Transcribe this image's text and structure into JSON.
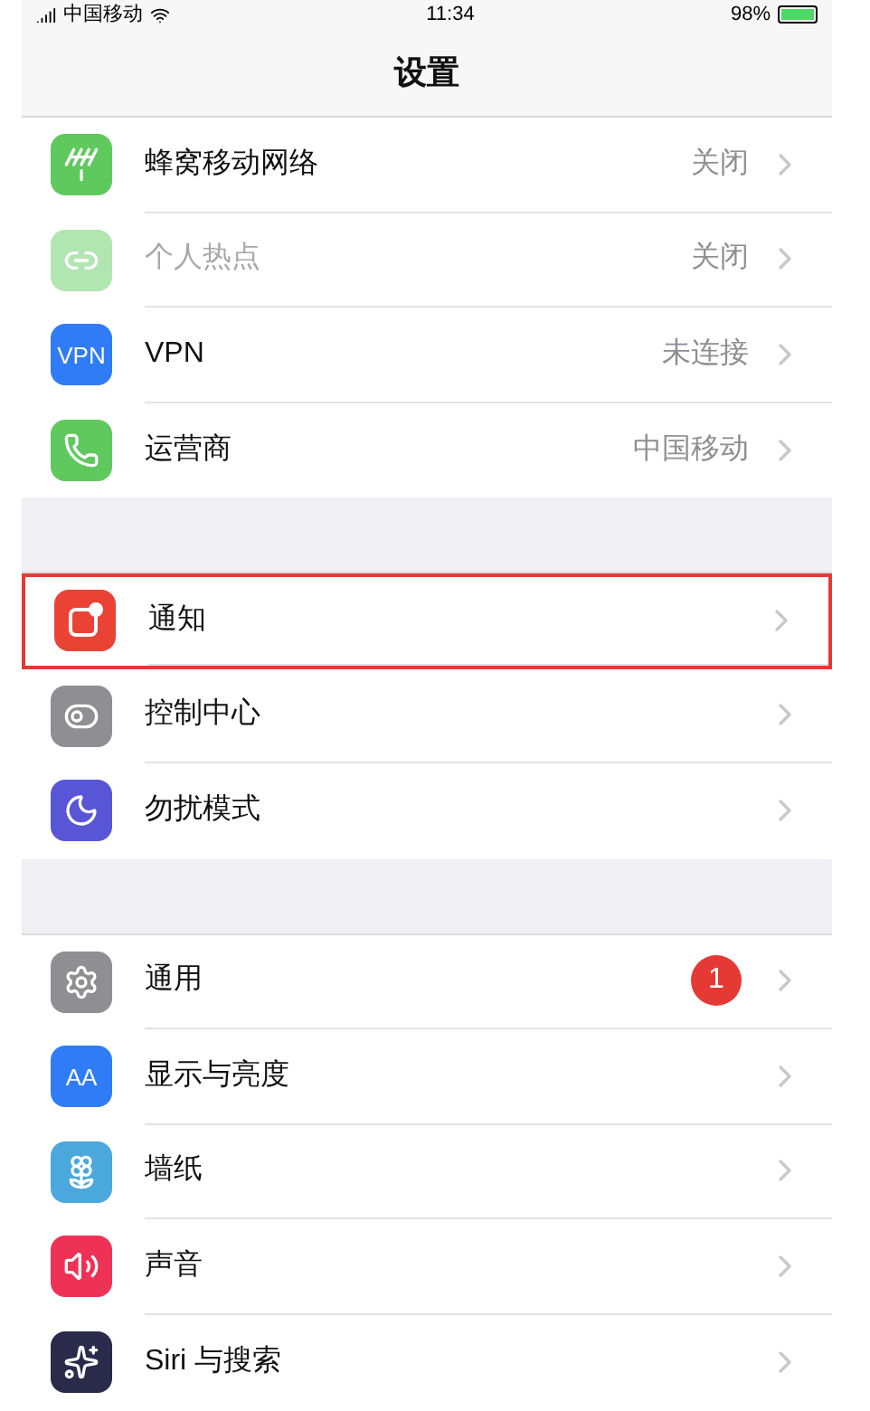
{
  "status_bar": {
    "carrier": "中国移动",
    "time": "11:34",
    "battery": "98%"
  },
  "nav": {
    "title": "设置"
  },
  "groups": [
    {
      "rows": [
        {
          "kind": "cellular",
          "color": "#5fc95d",
          "label": "蜂窝移动网络",
          "value": "关闭",
          "disabled": false,
          "highlighted": false
        },
        {
          "kind": "hotspot",
          "color": "#b2e6b1",
          "label": "个人热点",
          "value": "关闭",
          "disabled": true,
          "highlighted": false
        },
        {
          "kind": "vpn",
          "color": "#2f7cf6",
          "icon_text": "VPN",
          "label": "VPN",
          "value": "未连接",
          "disabled": false,
          "highlighted": false
        },
        {
          "kind": "phone",
          "color": "#5fc95d",
          "label": "运营商",
          "value": "中国移动",
          "disabled": false,
          "highlighted": false
        }
      ]
    },
    {
      "rows": [
        {
          "kind": "notifications",
          "color": "#ea4335",
          "label": "通知",
          "disabled": false,
          "highlighted": true
        },
        {
          "kind": "control",
          "color": "#8e8e93",
          "label": "控制中心",
          "disabled": false,
          "highlighted": false
        },
        {
          "kind": "moon",
          "color": "#5856d6",
          "label": "勿扰模式",
          "disabled": false,
          "highlighted": false
        }
      ]
    },
    {
      "rows": [
        {
          "kind": "gear",
          "color": "#8e8e93",
          "label": "通用",
          "badge": "1",
          "disabled": false,
          "highlighted": false
        },
        {
          "kind": "text",
          "color": "#2f7cf6",
          "icon_text": "AA",
          "label": "显示与亮度",
          "disabled": false,
          "highlighted": false
        },
        {
          "kind": "flower",
          "color": "#4aa8dc",
          "label": "墙纸",
          "disabled": false,
          "highlighted": false
        },
        {
          "kind": "speaker",
          "color": "#ee3256",
          "label": "声音",
          "disabled": false,
          "highlighted": false
        },
        {
          "kind": "siri",
          "color": "#2a2a4a",
          "label": "Siri 与搜索",
          "disabled": false,
          "highlighted": false
        }
      ]
    }
  ]
}
